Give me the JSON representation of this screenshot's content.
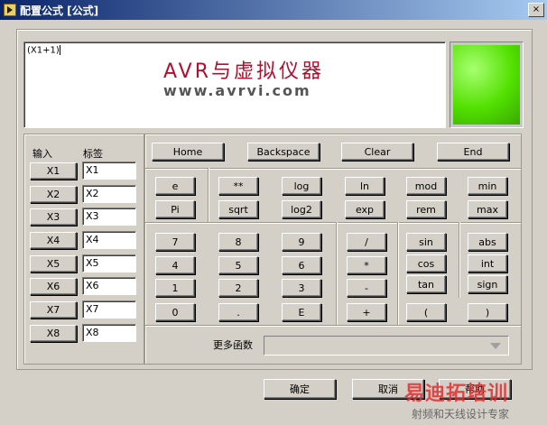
{
  "window": {
    "title": "配置公式 [公式]",
    "close_glyph": "×"
  },
  "display": {
    "formula": "(X1+1)",
    "watermark_title": "AVR与虚拟仪器",
    "watermark_url": "www.avrvi.com"
  },
  "inputs": {
    "header_input": "输入",
    "header_label": "标签",
    "rows": [
      {
        "button": "X1",
        "label": "X1"
      },
      {
        "button": "X2",
        "label": "X2"
      },
      {
        "button": "X3",
        "label": "X3"
      },
      {
        "button": "X4",
        "label": "X4"
      },
      {
        "button": "X5",
        "label": "X5"
      },
      {
        "button": "X6",
        "label": "X6"
      },
      {
        "button": "X7",
        "label": "X7"
      },
      {
        "button": "X8",
        "label": "X8"
      }
    ]
  },
  "nav": {
    "home": "Home",
    "backspace": "Backspace",
    "clear": "Clear",
    "end": "End"
  },
  "consts": {
    "e": "e",
    "pi": "Pi"
  },
  "funcs_top": [
    "**",
    "log",
    "ln",
    "mod",
    "min",
    "sqrt",
    "log2",
    "exp",
    "rem",
    "max"
  ],
  "digits": [
    "7",
    "8",
    "9",
    "4",
    "5",
    "6",
    "1",
    "2",
    "3",
    "0",
    ".",
    "E"
  ],
  "ops": [
    "/",
    "*",
    "-",
    "+"
  ],
  "trig": [
    "sin",
    "cos",
    "tan"
  ],
  "misc": [
    "abs",
    "int",
    "sign"
  ],
  "parens": [
    "(",
    ")"
  ],
  "more": {
    "label": "更多函数",
    "value": ""
  },
  "footer": {
    "ok": "确定",
    "cancel": "取消",
    "help": "帮助"
  },
  "watermark_footer": {
    "brand": "易迪拓培训",
    "slogan": "射频和天线设计专家"
  }
}
